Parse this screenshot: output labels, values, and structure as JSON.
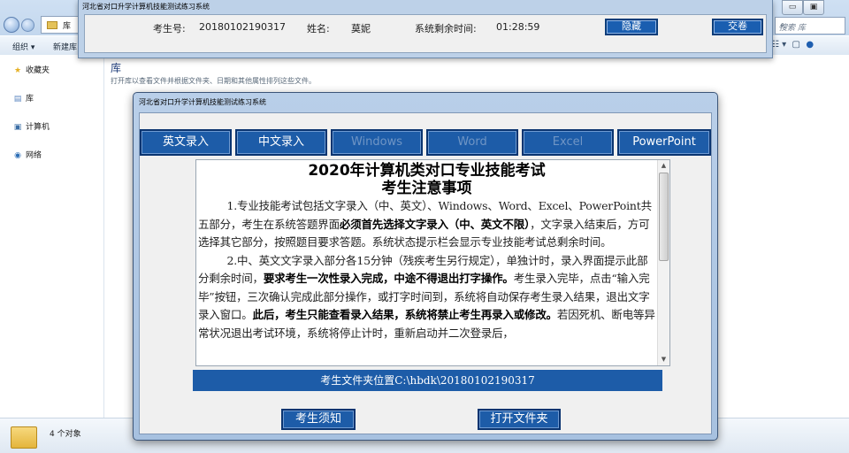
{
  "explorer": {
    "address_text": "库",
    "toolbar": {
      "organize": "组织 ▾",
      "new_library": "新建库"
    },
    "search_placeholder": "搜索 库",
    "window_controls": {
      "minimize": "▭",
      "maximize": "▣"
    },
    "sidebar": [
      {
        "label": "收藏夹",
        "icon": "star-icon"
      },
      {
        "label": "库",
        "icon": "library-icon"
      },
      {
        "label": "计算机",
        "icon": "computer-icon"
      },
      {
        "label": "网络",
        "icon": "network-icon"
      }
    ],
    "content_title": "库",
    "content_subtitle": "打开库以查看文件并根据文件夹、日期和其他属性排列这些文件。",
    "status_count": "4 个对象"
  },
  "status_window": {
    "title": "河北省对口升学计算机技能测试练习系统",
    "exam_id_label": "考生号:",
    "exam_id": "20180102190317",
    "name_label": "姓名:",
    "name": "莫妮",
    "time_label": "系统剩余时间:",
    "time_remaining": "01:28:59",
    "hide_button": "隐藏",
    "submit_button": "交卷"
  },
  "main_window": {
    "title": "河北省对口升学计算机技能测试练习系统",
    "tabs": [
      {
        "label": "英文录入",
        "active": true
      },
      {
        "label": "中文录入",
        "active": true
      },
      {
        "label": "Windows",
        "active": false
      },
      {
        "label": "Word",
        "active": false
      },
      {
        "label": "Excel",
        "active": false
      },
      {
        "label": "PowerPoint",
        "active": true
      }
    ],
    "notice": {
      "title_line1": "2020年计算机类对口专业技能考试",
      "title_line2": "考生注意事项",
      "p1_a": "1.专业技能考试包括文字录入（中、英文）、Windows、Word、Excel、PowerPoint共五部分，考生在系统答题界面",
      "p1_bold": "必须首先选择文字录入（中、英文不限）",
      "p1_b": "，文字录入结束后，方可选择其它部分，按照题目要求答题。系统状态提示栏会显示专业技能考试总剩余时间。",
      "p2_a": "2.中、英文文字录入部分各15分钟（残疾考生另行规定），单独计时，录入界面提示此部分剩余时间，",
      "p2_bold1": "要求考生一次性录入完成，中途不得退出打字操作。",
      "p2_b": "考生录入完毕，点击“输入完毕”按钮，三次确认完成此部分操作，或打字时间到，系统将自动保存考生录入结果，退出文字录入窗口。",
      "p2_bold2": "此后，考生只能查看录入结果，系统将禁止考生再录入或修改。",
      "p2_c": "若因死机、断电等异常状况退出考试环境，系统将停止计时，重新启动并二次登录后，"
    },
    "folder_path": "考生文件夹位置C:\\hbdk\\20180102190317",
    "notice_button": "考生须知",
    "open_folder_button": "打开文件夹"
  }
}
